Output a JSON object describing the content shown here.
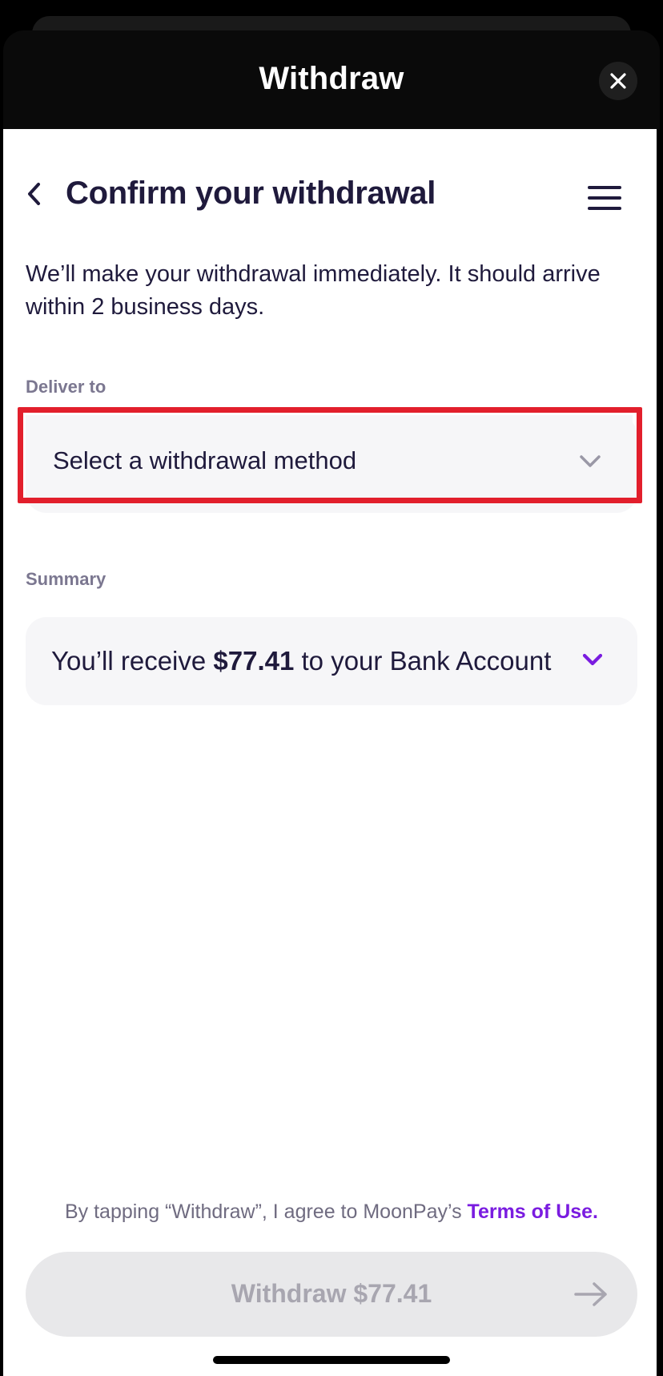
{
  "header": {
    "title": "Withdraw",
    "close_icon": "close-icon"
  },
  "page": {
    "title": "Confirm your withdrawal",
    "back_icon": "chevron-left-icon",
    "menu_icon": "hamburger-menu-icon",
    "description": "We’ll make your withdrawal immediately. It should arrive within 2 business days."
  },
  "deliver_to": {
    "label": "Deliver to",
    "placeholder": "Select a withdrawal method",
    "chevron_icon": "chevron-down-icon"
  },
  "summary": {
    "label": "Summary",
    "prefix": "You’ll receive ",
    "amount": "$77.41",
    "suffix": " to your Bank Account",
    "chevron_icon": "chevron-down-icon"
  },
  "terms": {
    "text": "By tapping “Withdraw”, I agree to MoonPay’s ",
    "link": "Terms of Use."
  },
  "cta": {
    "label": "Withdraw $77.41",
    "arrow_icon": "arrow-right-icon"
  },
  "colors": {
    "accent": "#7a1ce0",
    "highlight": "#e21f2c",
    "text_primary": "#1f1a3c",
    "text_muted": "#7b7790"
  }
}
